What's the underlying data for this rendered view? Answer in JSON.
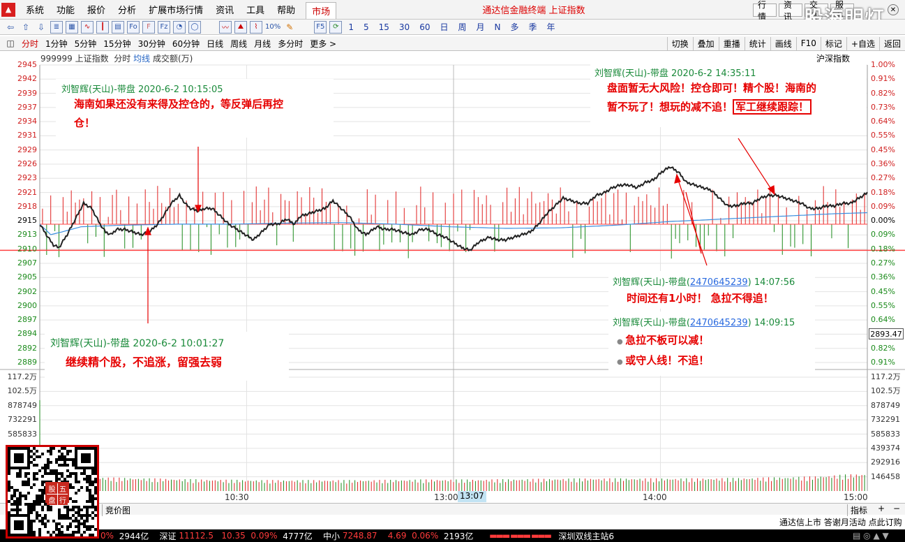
{
  "menu": {
    "items": [
      "系统",
      "功能",
      "报价",
      "分析",
      "扩展市场行情",
      "资讯",
      "工具",
      "帮助"
    ],
    "market_tab": "市场",
    "title": "通达信金融终端 上证指数",
    "right_buttons": [
      "行情",
      "资讯",
      "交易",
      "服务"
    ],
    "watermark": "股海明灯"
  },
  "toolbar": {
    "icons": [
      "back-icon",
      "up-arrow-icon",
      "down-arrow-icon",
      "list-icon",
      "table-icon",
      "line-chart-icon",
      "kline-icon",
      "f10-icon",
      "fo-icon",
      "f-icon",
      "fz-icon",
      "chart-icon",
      "circle-icon",
      "wave-icon",
      "mountain-icon",
      "graph-icon",
      "percent-icon",
      "pencil-icon",
      "f5-icon",
      "refresh-icon"
    ],
    "periods": [
      "1",
      "5",
      "15",
      "30",
      "60",
      "日",
      "周",
      "月",
      "N",
      "多",
      "季",
      "年"
    ]
  },
  "tabs": {
    "left": [
      "分时",
      "1分钟",
      "5分钟",
      "15分钟",
      "30分钟",
      "60分钟",
      "日线",
      "周线",
      "月线",
      "多分时",
      "更多 >"
    ],
    "active": "分时",
    "right": [
      "切换",
      "叠加",
      "重播",
      "统计",
      "画线",
      "F10",
      "标记",
      "+自选",
      "返回"
    ]
  },
  "chart_header": {
    "code": "999999",
    "name": "上证指数",
    "mode": "分时",
    "avg": "均线",
    "volume": "成交额(万)"
  },
  "region_label": "沪深指数",
  "axes": {
    "price_ticks": [
      "2945",
      "2942",
      "2939",
      "2937",
      "2934",
      "2931",
      "2929",
      "2926",
      "2923",
      "2921",
      "2918",
      "2915",
      "2913",
      "2910",
      "2907",
      "2905",
      "2902",
      "2900",
      "2897",
      "2894",
      "2892",
      "2889"
    ],
    "pct_ticks": [
      "1.00%",
      "0.91%",
      "0.82%",
      "0.73%",
      "0.64%",
      "0.55%",
      "0.45%",
      "0.36%",
      "0.27%",
      "0.18%",
      "0.09%",
      "0.00%",
      "0.09%",
      "0.18%",
      "0.27%",
      "0.36%",
      "0.45%",
      "0.55%",
      "0.64%",
      "0.73%",
      "0.82%",
      "0.91%"
    ],
    "vol_ticks_left": [
      "117.2万",
      "102.5万",
      "878749",
      "732291",
      "585833"
    ],
    "vol_ticks_right": [
      "117.2万",
      "102.5万",
      "878749",
      "732291",
      "585833",
      "439374",
      "292916",
      "146458"
    ],
    "current_price": "2893.47",
    "time_labels": [
      "10:30",
      "13:00",
      "14:00",
      "15:00"
    ],
    "time_highlight": "13:07"
  },
  "chart_data": {
    "type": "line",
    "x_range": [
      "09:30",
      "15:00"
    ],
    "ylim": [
      2888,
      2945
    ],
    "prev_close": 2915,
    "price_series": [
      [
        0,
        2915
      ],
      [
        6,
        2912.5
      ],
      [
        10,
        2911
      ],
      [
        14,
        2910.5
      ],
      [
        20,
        2913
      ],
      [
        26,
        2916
      ],
      [
        32,
        2919
      ],
      [
        38,
        2918
      ],
      [
        44,
        2915
      ],
      [
        48,
        2913.5
      ],
      [
        52,
        2913
      ],
      [
        56,
        2914
      ],
      [
        62,
        2914
      ],
      [
        68,
        2913.5
      ],
      [
        74,
        2913
      ],
      [
        80,
        2913.5
      ],
      [
        86,
        2915
      ],
      [
        90,
        2916.5
      ],
      [
        96,
        2919
      ],
      [
        102,
        2920.5
      ],
      [
        106,
        2919
      ],
      [
        110,
        2918
      ],
      [
        116,
        2917.5
      ],
      [
        120,
        2918
      ],
      [
        126,
        2918
      ],
      [
        132,
        2916.5
      ],
      [
        138,
        2915
      ],
      [
        144,
        2914
      ],
      [
        150,
        2913
      ],
      [
        156,
        2912
      ],
      [
        162,
        2913.5
      ],
      [
        168,
        2915
      ],
      [
        174,
        2915
      ],
      [
        180,
        2916
      ],
      [
        186,
        2915
      ],
      [
        190,
        2916.5
      ],
      [
        196,
        2917
      ],
      [
        202,
        2917.5
      ],
      [
        208,
        2918
      ],
      [
        214,
        2919.5
      ],
      [
        220,
        2918
      ],
      [
        226,
        2916.5
      ],
      [
        232,
        2914
      ],
      [
        238,
        2913
      ],
      [
        246,
        2914.5
      ],
      [
        252,
        2914
      ],
      [
        258,
        2914
      ],
      [
        264,
        2913.5
      ],
      [
        272,
        2913
      ],
      [
        278,
        2914
      ],
      [
        284,
        2914
      ],
      [
        290,
        2913
      ],
      [
        296,
        2912.5
      ],
      [
        302,
        2911.5
      ],
      [
        308,
        2910.5
      ],
      [
        314,
        2910
      ],
      [
        320,
        2911.5
      ],
      [
        328,
        2912.5
      ],
      [
        334,
        2912
      ],
      [
        340,
        2912
      ],
      [
        346,
        2912.5
      ],
      [
        352,
        2913
      ],
      [
        358,
        2913.5
      ],
      [
        364,
        2915
      ],
      [
        370,
        2917
      ],
      [
        376,
        2918.5
      ],
      [
        382,
        2920
      ],
      [
        388,
        2919.5
      ],
      [
        394,
        2919
      ],
      [
        400,
        2919
      ],
      [
        406,
        2920.5
      ],
      [
        412,
        2921
      ],
      [
        418,
        2922
      ],
      [
        424,
        2922.5
      ],
      [
        430,
        2922.5
      ],
      [
        436,
        2922
      ],
      [
        442,
        2923
      ],
      [
        448,
        2923.5
      ],
      [
        454,
        2925
      ],
      [
        460,
        2926
      ],
      [
        466,
        2925
      ],
      [
        472,
        2923
      ],
      [
        478,
        2922.5
      ],
      [
        484,
        2922
      ],
      [
        490,
        2921.5
      ],
      [
        496,
        2920
      ],
      [
        502,
        2918.5
      ],
      [
        508,
        2918.5
      ],
      [
        514,
        2919
      ],
      [
        520,
        2919
      ],
      [
        526,
        2920
      ],
      [
        532,
        2920.5
      ],
      [
        538,
        2920.5
      ],
      [
        544,
        2920
      ],
      [
        550,
        2919.5
      ],
      [
        556,
        2919
      ],
      [
        562,
        2918
      ],
      [
        568,
        2918
      ],
      [
        574,
        2918.5
      ],
      [
        580,
        2918.5
      ],
      [
        586,
        2919
      ],
      [
        592,
        2919
      ],
      [
        598,
        2920
      ],
      [
        604,
        2921
      ]
    ],
    "avg_series": [
      [
        0,
        2915
      ],
      [
        8,
        2913
      ],
      [
        16,
        2913.5
      ],
      [
        30,
        2914.5
      ],
      [
        60,
        2914.8
      ],
      [
        100,
        2915
      ],
      [
        140,
        2915
      ],
      [
        180,
        2915.2
      ],
      [
        220,
        2915.3
      ],
      [
        260,
        2915
      ],
      [
        300,
        2914.5
      ],
      [
        340,
        2914.2
      ],
      [
        380,
        2914.3
      ],
      [
        420,
        2914.8
      ],
      [
        460,
        2915.5
      ],
      [
        500,
        2916
      ],
      [
        540,
        2916.5
      ],
      [
        580,
        2917
      ],
      [
        604,
        2917.2
      ]
    ],
    "volume_series": [
      [
        0,
        1170000
      ],
      [
        2,
        180000
      ],
      [
        10,
        140000
      ],
      [
        40,
        120000
      ],
      [
        80,
        110000
      ],
      [
        120,
        100000
      ],
      [
        160,
        95000
      ],
      [
        200,
        95000
      ],
      [
        240,
        95000
      ],
      [
        280,
        100000
      ],
      [
        320,
        100000
      ],
      [
        360,
        105000
      ],
      [
        400,
        110000
      ],
      [
        440,
        110000
      ],
      [
        480,
        110000
      ],
      [
        520,
        115000
      ],
      [
        560,
        125000
      ],
      [
        600,
        150000
      ]
    ]
  },
  "annotations": [
    {
      "title": "刘智辉(天山)-带盘 2020-6-2 10:15:05",
      "lines": [
        "海南如果还没有来得及控仓的，等反弹后再控",
        "仓！"
      ]
    },
    {
      "title": "刘智辉(天山)-带盘 2020-6-2 14:35:11",
      "lines": [
        "盘面暂无大风险！控仓即可！精个股！海南的",
        "暂不玩了！想玩的减不追！"
      ],
      "boxed": "军工继续跟踪！"
    },
    {
      "title": "刘智辉(天山)-带盘 2020-6-2 10:01:27",
      "lines": [
        "继续精个股，不追涨，留强去弱"
      ]
    },
    {
      "title_prefix": "刘智辉(天山)-带盘(",
      "title_link": "2470645239",
      "title_suffix": ") 14:07:56",
      "lines": [
        "时间还有1小时！ 急拉不得追！"
      ]
    },
    {
      "title_prefix": "刘智辉(天山)-带盘(",
      "title_link": "2470645239",
      "title_suffix": ") 14:09:15",
      "lines": [
        "急拉不板可以减！",
        "或守人线！不追！"
      ]
    }
  ],
  "bottom": {
    "tab": "竞价图",
    "buttons": [
      "指标",
      "+",
      "−"
    ],
    "marquee": "通达信上市 答谢月活动 点此订购"
  },
  "status": {
    "first_pct": "0%",
    "first_amt": "2944亿",
    "items": [
      {
        "name": "深证",
        "value": "11112.5",
        "chg": "10.35",
        "pct": "0.09%",
        "amt": "4777亿"
      },
      {
        "name": "中小",
        "value": "7248.87",
        "chg": "4.69",
        "pct": "0.06%",
        "amt": "2193亿"
      }
    ],
    "server": "深圳双线主站6"
  },
  "qr": {
    "badge": [
      "股",
      "五",
      "盘",
      "行"
    ]
  },
  "colors": {
    "up": "#e02020",
    "down": "#1a8a1a",
    "price_line": "#222222",
    "avg_line": "#3a8ee0",
    "note_red": "#e60000",
    "note_green": "#1a8a3a"
  }
}
